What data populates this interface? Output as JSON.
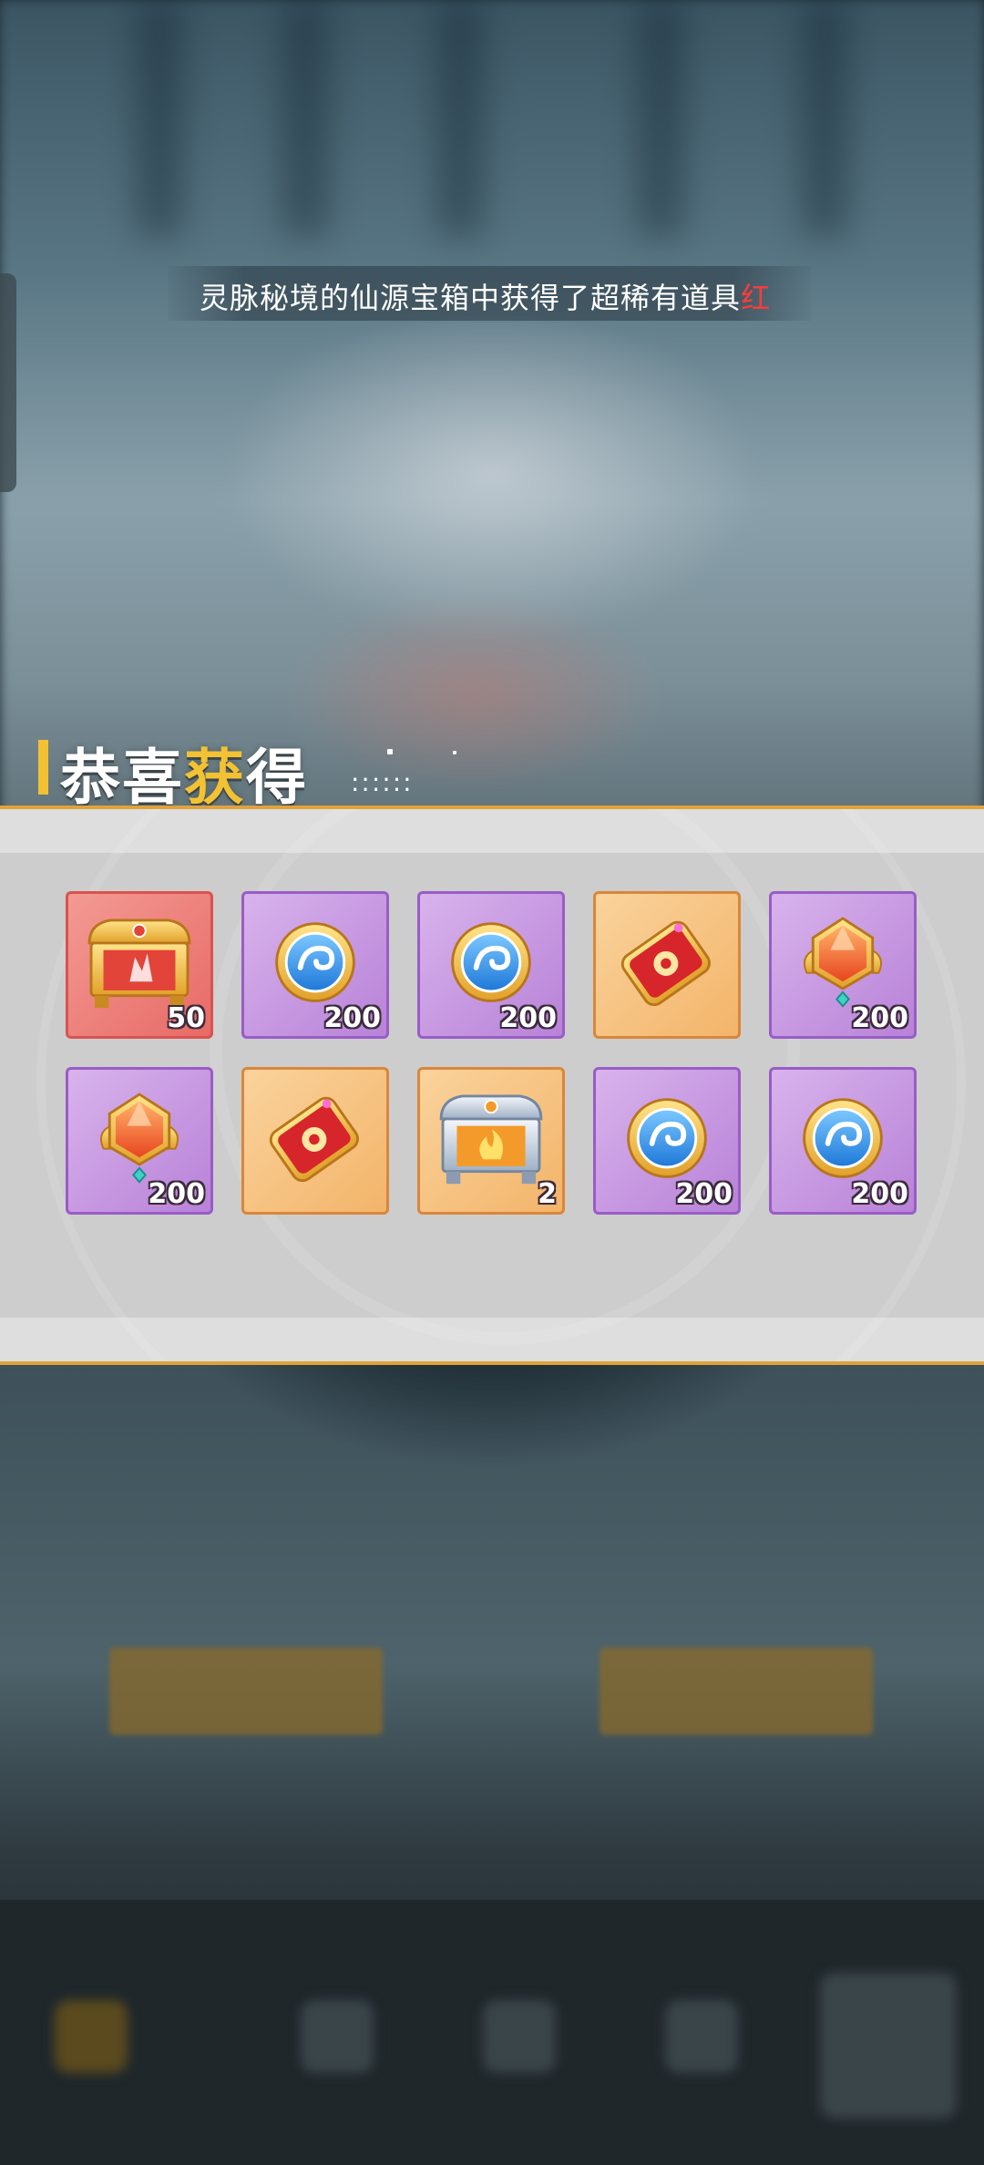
{
  "announcement": {
    "text": "灵脉秘境的仙源宝箱中获得了超稀有道具",
    "highlight": "红"
  },
  "reward_title": {
    "part1": "恭喜",
    "part2": "获",
    "part3": "得",
    "dots": "::::::"
  },
  "colors": {
    "panel_border": "#e0a23a",
    "title_accent": "#f2c232",
    "rarity_red": "#d9534f",
    "rarity_purple": "#9a5cc6",
    "rarity_orange": "#d9873a"
  },
  "rewards": [
    {
      "icon": "red-treasure-chest-icon",
      "rarity": "red",
      "quantity": "50"
    },
    {
      "icon": "blue-spirit-coin-icon",
      "rarity": "purple",
      "quantity": "200"
    },
    {
      "icon": "blue-spirit-coin-icon",
      "rarity": "purple",
      "quantity": "200"
    },
    {
      "icon": "red-talisman-ticket-icon",
      "rarity": "orange",
      "quantity": ""
    },
    {
      "icon": "orange-gem-crest-icon",
      "rarity": "purple",
      "quantity": "200"
    },
    {
      "icon": "orange-gem-crest-icon",
      "rarity": "purple",
      "quantity": "200"
    },
    {
      "icon": "red-talisman-ticket-icon",
      "rarity": "orange",
      "quantity": ""
    },
    {
      "icon": "silver-treasure-chest-icon",
      "rarity": "orange",
      "quantity": "2"
    },
    {
      "icon": "blue-spirit-coin-icon",
      "rarity": "purple",
      "quantity": "200"
    },
    {
      "icon": "blue-spirit-coin-icon",
      "rarity": "purple",
      "quantity": "200"
    }
  ]
}
